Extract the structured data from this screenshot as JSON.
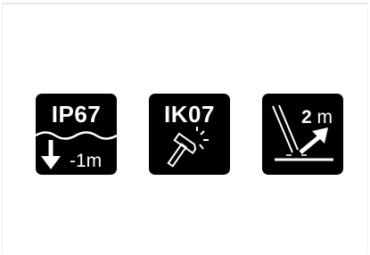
{
  "badges": {
    "ip": {
      "code": "IP67",
      "depth": "-1m"
    },
    "ik": {
      "code": "IK07"
    },
    "drop": {
      "height": "2",
      "unit": "m"
    }
  },
  "icons": [
    "water-wave-icon",
    "down-arrow-icon",
    "hammer-impact-icon",
    "drop-test-icon",
    "up-arrow-icon"
  ],
  "colors": {
    "badge_background": "#000000",
    "badge_foreground": "#ffffff",
    "page_background": "#ffffff"
  }
}
